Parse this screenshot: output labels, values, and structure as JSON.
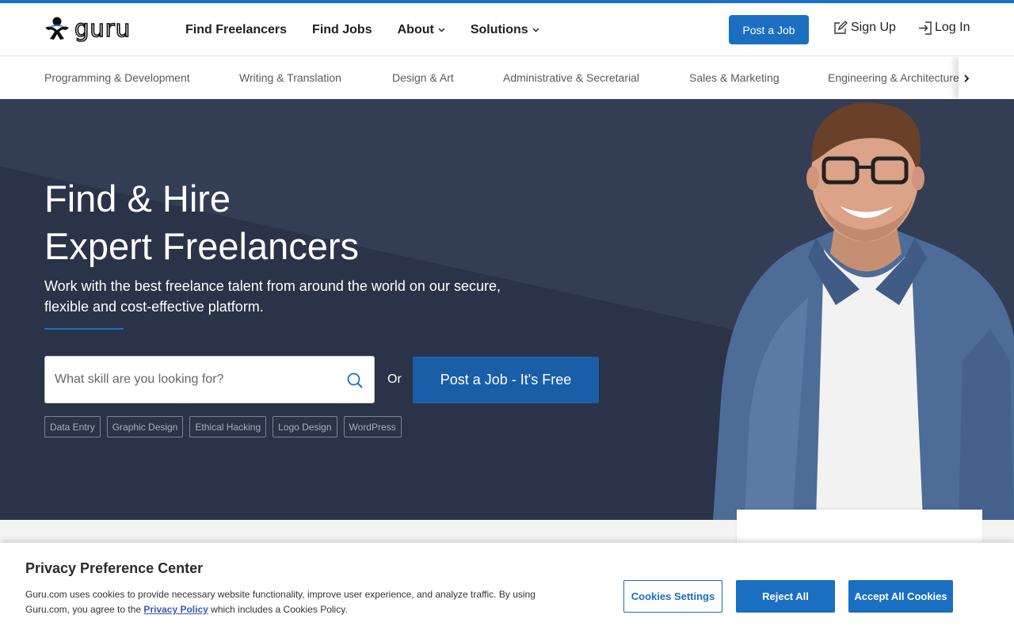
{
  "brand": {
    "logo_text": "guru",
    "accent_color": "#1a73c8",
    "primary_button_color": "#1a6fc1",
    "hero_bg_color": "#2a3347"
  },
  "header": {
    "nav": [
      {
        "label": "Find Freelancers",
        "has_dropdown": false
      },
      {
        "label": "Find Jobs",
        "has_dropdown": false
      },
      {
        "label": "About",
        "has_dropdown": true
      },
      {
        "label": "Solutions",
        "has_dropdown": true
      }
    ],
    "post_job_label": "Post a Job",
    "signup_label": "Sign Up",
    "login_label": "Log In",
    "signup_icon": "edit-icon",
    "login_icon": "login-icon"
  },
  "categories": [
    "Programming & Development",
    "Writing & Translation",
    "Design & Art",
    "Administrative & Secretarial",
    "Sales & Marketing",
    "Engineering & Architecture"
  ],
  "hero": {
    "title_line1": "Find & Hire",
    "title_line2": "Expert Freelancers",
    "subtitle": "Work with the best freelance talent from around the world on our secure, flexible and cost-effective platform.",
    "search_placeholder": "What skill are you looking for?",
    "or_label": "Or",
    "cta_label": "Post a Job - It's Free",
    "tags": [
      "Data Entry",
      "Graphic Design",
      "Ethical Hacking",
      "Logo Design",
      "WordPress"
    ]
  },
  "cookie_banner": {
    "title": "Privacy Preference Center",
    "text_before_link": "Guru.com uses cookies to provide necessary website functionality, improve user experience, and analyze traffic. By using Guru.com, you agree to the ",
    "link_label": "Privacy Policy",
    "text_after_link": " which includes a Cookies Policy.",
    "settings_label": "Cookies Settings",
    "reject_label": "Reject All",
    "accept_label": "Accept All Cookies"
  }
}
